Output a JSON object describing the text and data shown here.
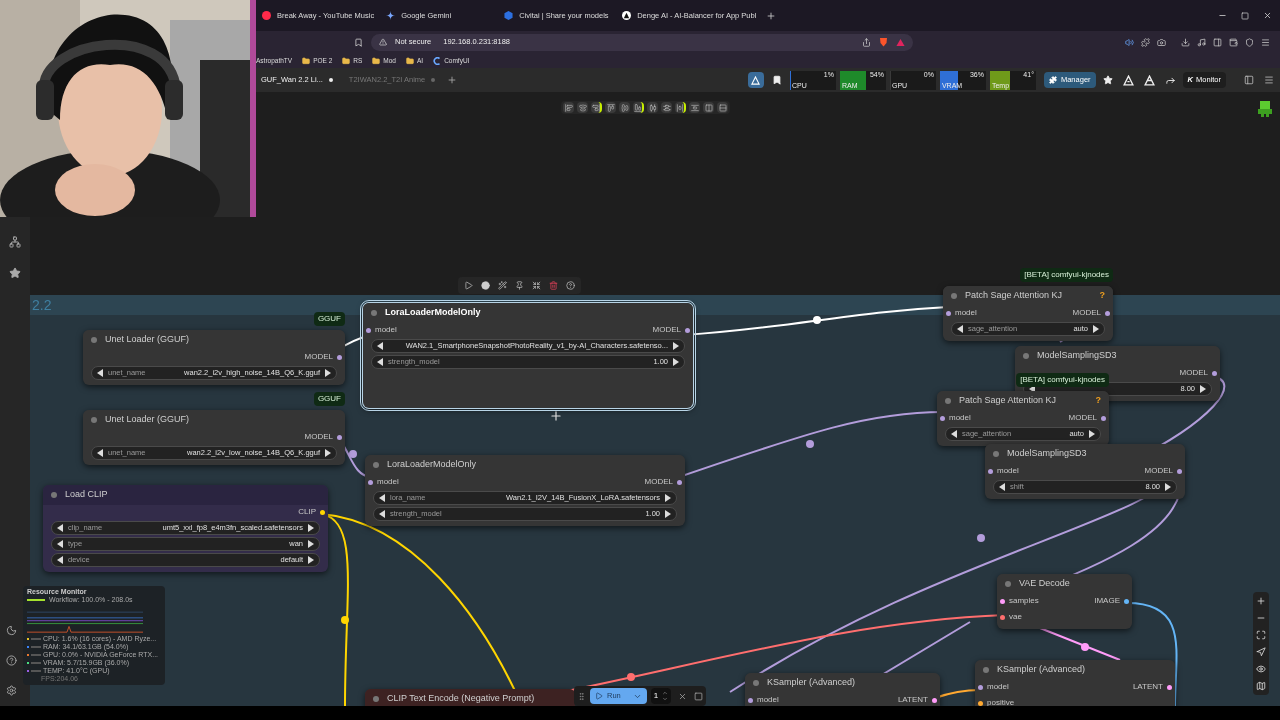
{
  "browser": {
    "tabs": [
      {
        "title": "Break Away - YouTube Music"
      },
      {
        "title": "Google Gemini"
      },
      {
        "title": "Civitai | Share your models"
      },
      {
        "title": "Denge AI - AI-Balancer for App Publ"
      }
    ],
    "security": "Not secure",
    "url": "192.168.0.231:8188",
    "bookmarks": [
      {
        "label": "AstropathTV",
        "kind": "site"
      },
      {
        "label": "POE 2",
        "kind": "folder"
      },
      {
        "label": "RS",
        "kind": "folder"
      },
      {
        "label": "Mod",
        "kind": "folder"
      },
      {
        "label": "AI",
        "kind": "folder"
      },
      {
        "label": "ComfyUI",
        "kind": "site"
      }
    ]
  },
  "workflow_tabs": [
    {
      "label": "GUF_Wan 2.2 Li...",
      "selected": true,
      "modified": true
    },
    {
      "label": "T2IWAN2.2_T2I Anime",
      "selected": false,
      "modified": true
    }
  ],
  "meters": [
    {
      "label": "CPU",
      "value": "1%",
      "level": 0.01,
      "color": "#2f6fd6"
    },
    {
      "label": "RAM",
      "value": "54%",
      "level": 0.54,
      "color": "#1e8a2a"
    },
    {
      "label": "GPU",
      "value": "0%",
      "level": 0
    },
    {
      "label": "VRAM",
      "value": "36%",
      "level": 0.36,
      "color": "#2f6fd6"
    },
    {
      "label": "Temp",
      "value": "41°",
      "level": 0.41,
      "color": "#6f9a1a"
    }
  ],
  "toolbar": {
    "manager": "Manager",
    "monitor_logo": "K",
    "monitor": "Monitor"
  },
  "canvas": {
    "group_title": "2.2",
    "nodes": [
      {
        "title": "Unet Loader (GGUF)",
        "kind": "plain",
        "selected": false,
        "badge": "GGUF",
        "outputs": [
          {
            "name": "MODEL",
            "color": "#b39ddb"
          }
        ],
        "widgets": [
          {
            "name": "unet_name",
            "value": "wan2.2_i2v_high_noise_14B_Q6_K.gguf"
          }
        ]
      },
      {
        "title": "LoraLoaderModelOnly",
        "kind": "plain",
        "selected": true,
        "inputs": [
          {
            "name": "model",
            "color": "#b39ddb"
          }
        ],
        "outputs": [
          {
            "name": "MODEL",
            "color": "#b39ddb"
          }
        ],
        "widgets": [
          {
            "value": "WAN2.1_SmartphoneSnapshotPhotoReality_v1_by-AI_Characters.safetenso..."
          },
          {
            "name": "strength_model",
            "value": "1.00"
          }
        ]
      },
      {
        "title": "Unet Loader (GGUF)",
        "kind": "plain",
        "selected": false,
        "badge": "GGUF",
        "outputs": [
          {
            "name": "MODEL",
            "color": "#b39ddb"
          }
        ],
        "widgets": [
          {
            "name": "unet_name",
            "value": "wan2.2_i2v_low_noise_14B_Q6_K.gguf"
          }
        ]
      },
      {
        "title": "LoraLoaderModelOnly",
        "kind": "plain",
        "selected": false,
        "inputs": [
          {
            "name": "model",
            "color": "#b39ddb"
          }
        ],
        "outputs": [
          {
            "name": "MODEL",
            "color": "#b39ddb"
          }
        ],
        "widgets": [
          {
            "name": "lora_name",
            "value": "Wan2.1_I2V_14B_FusionX_LoRA.safetensors"
          },
          {
            "name": "strength_model",
            "value": "1.00"
          }
        ]
      },
      {
        "title": "Load CLIP",
        "kind": "clip",
        "selected": false,
        "outputs": [
          {
            "name": "CLIP",
            "color": "#ffd500"
          }
        ],
        "widgets": [
          {
            "name": "clip_name",
            "value": "umt5_xxl_fp8_e4m3fn_scaled.safetensors"
          },
          {
            "name": "type",
            "value": "wan"
          },
          {
            "name": "device",
            "value": "default"
          }
        ]
      },
      {
        "title": "Patch Sage Attention KJ",
        "kind": "plain",
        "selected": false,
        "badge": "[BETA] comfyui-kjnodes",
        "help": "?",
        "inputs": [
          {
            "name": "model",
            "color": "#b39ddb"
          }
        ],
        "outputs": [
          {
            "name": "MODEL",
            "color": "#b39ddb"
          }
        ],
        "widgets": [
          {
            "name": "sage_attention",
            "value": "auto"
          }
        ]
      },
      {
        "title": "ModelSamplingSD3",
        "kind": "plain",
        "selected": false,
        "outputs": [
          {
            "name": "MODEL",
            "color": "#b39ddb"
          }
        ],
        "widgets": [
          {
            "value": "8.00"
          }
        ]
      },
      {
        "title": "Patch Sage Attention KJ",
        "kind": "plain",
        "selected": false,
        "badge": "[BETA] comfyui-kjnodes",
        "help": "?",
        "inputs": [
          {
            "name": "model",
            "color": "#b39ddb"
          }
        ],
        "outputs": [
          {
            "name": "MODEL",
            "color": "#b39ddb"
          }
        ],
        "widgets": [
          {
            "name": "sage_attention",
            "value": "auto"
          }
        ]
      },
      {
        "title": "ModelSamplingSD3",
        "kind": "plain",
        "selected": false,
        "inputs": [
          {
            "name": "model",
            "color": "#b39ddb"
          }
        ],
        "outputs": [
          {
            "name": "MODEL",
            "color": "#b39ddb"
          }
        ],
        "widgets": [
          {
            "name": "shift",
            "value": "8.00"
          }
        ]
      },
      {
        "title": "VAE Decode",
        "kind": "plain",
        "selected": false,
        "inputs": [
          {
            "name": "samples",
            "color": "#ff9cf9"
          },
          {
            "name": "vae",
            "color": "#ff6e6e"
          }
        ],
        "outputs": [
          {
            "name": "IMAGE",
            "color": "#64b5f6"
          }
        ]
      },
      {
        "title": "CLIP Text Encode (Negative Prompt)",
        "kind": "negative",
        "selected": false
      },
      {
        "title": "KSampler (Advanced)",
        "kind": "plain",
        "selected": false,
        "inputs": [
          {
            "name": "model",
            "color": "#b39ddb"
          }
        ],
        "outputs": [
          {
            "name": "LATENT",
            "color": "#ff9cf9"
          }
        ]
      },
      {
        "title": "KSampler (Advanced)",
        "kind": "plain",
        "selected": false,
        "inputs": [
          {
            "name": "model",
            "color": "#b39ddb"
          },
          {
            "name": "positive",
            "color": "#ffa931"
          }
        ],
        "outputs": [
          {
            "name": "LATENT",
            "color": "#ff9cf9"
          }
        ]
      }
    ]
  },
  "resource_monitor": {
    "title": "Resource Monitor",
    "lines": [
      {
        "text": "Workflow: 100.0% - 208.0s",
        "color": "#a6e22e"
      },
      {
        "text": "CPU: 1.6% (16 cores) - AMD Ryze...",
        "color": "#e6c229"
      },
      {
        "text": "RAM: 34.1/63.1GB (54.0%)",
        "color": "#3b82f6"
      },
      {
        "text": "GPU: 0.0% - NVIDIA GeForce RTX...",
        "color": "#e8772e"
      },
      {
        "text": "VRAM: 5.7/15.9GB (36.0%)",
        "color": "#4ade80"
      },
      {
        "text": "TEMP: 41.0°C (GPU)",
        "color": "#9b5de5"
      }
    ],
    "fps": "FPS:204.06"
  },
  "run_bar": {
    "run": "Run",
    "count": "1"
  }
}
